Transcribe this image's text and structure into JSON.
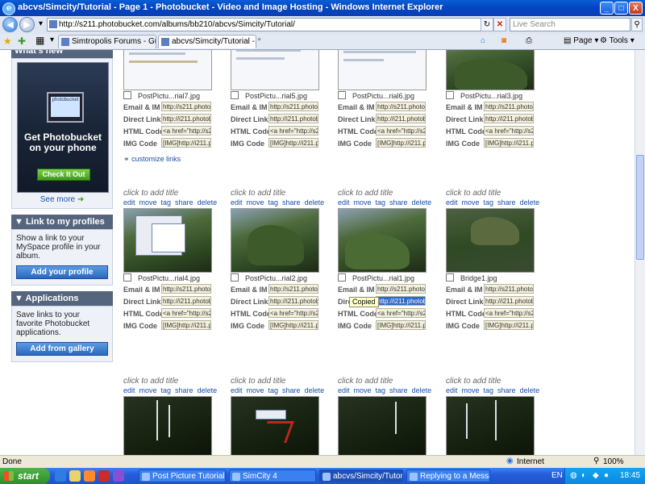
{
  "window": {
    "title": "abcvs/Simcity/Tutorial - Page 1 - Photobucket - Video and Image Hosting - Windows Internet Explorer",
    "minimize": "_",
    "maximize": "□",
    "close": "X"
  },
  "address": {
    "url": "http://s211.photobucket.com/albums/bb210/abcvs/Simcity/Tutorial/",
    "search_placeholder": "Live Search"
  },
  "tabs": [
    {
      "label": "Simtropolis Forums - Guidelin..."
    },
    {
      "label": "abcvs/Simcity/Tutorial - P..."
    }
  ],
  "commands": {
    "page": "Page",
    "tools": "Tools"
  },
  "sidebar": {
    "whats_new": "What's new",
    "promo_screen": "photobucket",
    "promo_title": "Get Photobucket on your phone",
    "promo_button": "Check It Out",
    "see_more": "See more",
    "profiles": {
      "heading": "Link to my profiles",
      "text": "Show a link to your MySpace profile in your album.",
      "button": "Add your profile"
    },
    "apps": {
      "heading": "Applications",
      "text": "Save links to your favorite Photobucket applications.",
      "button": "Add from gallery"
    }
  },
  "labels": {
    "email": "Email & IM",
    "direct": "Direct Link",
    "html": "HTML Code",
    "img": "IMG Code",
    "email_val": "http://s211.photobu",
    "direct_val": "http://i211.photobu",
    "html_val": "<a href=\"http://s211",
    "img_val": "[IMG]http://i211.ph",
    "click_title": "click to add title",
    "customize": "customize links",
    "copied": "Copied",
    "actions": [
      "edit",
      "move",
      "tag",
      "share",
      "delete"
    ]
  },
  "row1": [
    {
      "name": "PostPictu...rial7.jpg"
    },
    {
      "name": "PostPictu...rial5.jpg"
    },
    {
      "name": "PostPictu...rial6.jpg"
    },
    {
      "name": "PostPictu...rial3.jpg"
    }
  ],
  "row2": [
    {
      "name": "PostPictu...rial4.jpg"
    },
    {
      "name": "PostPictu...rial2.jpg"
    },
    {
      "name": "PostPictu...rial1.jpg"
    },
    {
      "name": "Bridge1.jpg"
    }
  ],
  "status": {
    "left": "Done",
    "zone": "Internet",
    "zoom": "100%"
  },
  "taskbar": {
    "start": "start",
    "tasks": [
      {
        "label": "Post Picture Tutorial ..."
      },
      {
        "label": "SimCity 4"
      },
      {
        "label": "abcvs/Simcity/Tutoria..."
      },
      {
        "label": "Replying to a Messag..."
      }
    ],
    "lang": "EN",
    "time": "18:45"
  }
}
